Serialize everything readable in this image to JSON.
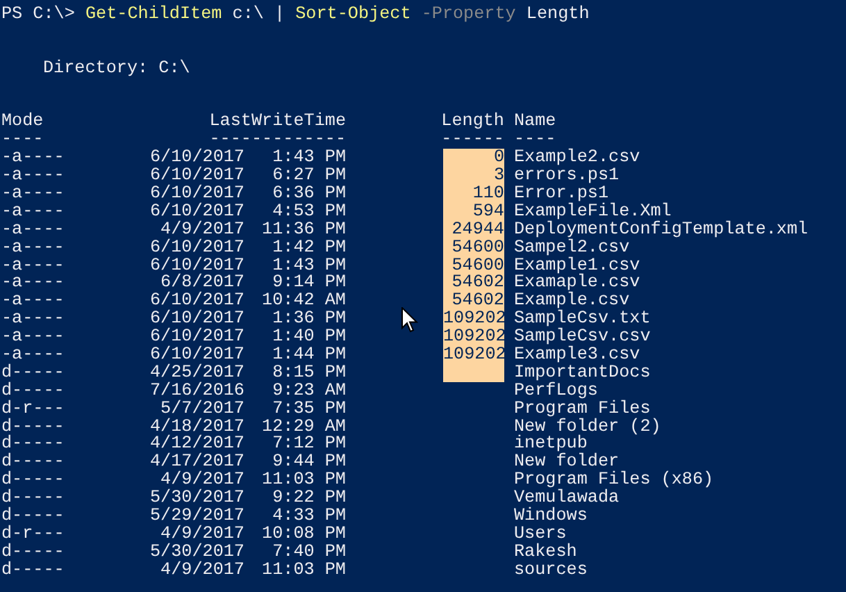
{
  "command_line": [
    {
      "kind": "prompt",
      "text": "PS C:\\> "
    },
    {
      "kind": "command",
      "text": "Get-ChildItem"
    },
    {
      "kind": "plain",
      "text": " c:\\ | "
    },
    {
      "kind": "command",
      "text": "Sort-Object"
    },
    {
      "kind": "parameter",
      "text": " -Property"
    },
    {
      "kind": "plain",
      "text": " Length"
    }
  ],
  "directory": "Directory: C:\\",
  "columns": {
    "mode": "Mode",
    "last_write_time": "LastWriteTime",
    "length": "Length",
    "name": "Name"
  },
  "underlines": {
    "mode": "----",
    "last_write_time": "-------------",
    "length": "------",
    "name": "----"
  },
  "rows": [
    {
      "mode": "-a----",
      "date": "6/10/2017",
      "time": "1:43 PM",
      "length": "0",
      "name": "Example2.csv",
      "highlighted": true
    },
    {
      "mode": "-a----",
      "date": "6/10/2017",
      "time": "6:27 PM",
      "length": "3",
      "name": "errors.ps1",
      "highlighted": true
    },
    {
      "mode": "-a----",
      "date": "6/10/2017",
      "time": "6:36 PM",
      "length": "110",
      "name": "Error.ps1",
      "highlighted": true
    },
    {
      "mode": "-a----",
      "date": "6/10/2017",
      "time": "4:53 PM",
      "length": "594",
      "name": "ExampleFile.Xml",
      "highlighted": true
    },
    {
      "mode": "-a----",
      "date": "4/9/2017",
      "time": "11:36 PM",
      "length": "24944",
      "name": "DeploymentConfigTemplate.xml",
      "highlighted": true
    },
    {
      "mode": "-a----",
      "date": "6/10/2017",
      "time": "1:42 PM",
      "length": "54600",
      "name": "Sampel2.csv",
      "highlighted": true
    },
    {
      "mode": "-a----",
      "date": "6/10/2017",
      "time": "1:43 PM",
      "length": "54600",
      "name": "Example1.csv",
      "highlighted": true
    },
    {
      "mode": "-a----",
      "date": "6/8/2017",
      "time": "9:14 PM",
      "length": "54602",
      "name": "Examaple.csv",
      "highlighted": true
    },
    {
      "mode": "-a----",
      "date": "6/10/2017",
      "time": "10:42 AM",
      "length": "54602",
      "name": "Example.csv",
      "highlighted": true
    },
    {
      "mode": "-a----",
      "date": "6/10/2017",
      "time": "1:36 PM",
      "length": "109202",
      "name": "SampleCsv.txt",
      "highlighted": true
    },
    {
      "mode": "-a----",
      "date": "6/10/2017",
      "time": "1:40 PM",
      "length": "109202",
      "name": "SampleCsv.csv",
      "highlighted": true
    },
    {
      "mode": "-a----",
      "date": "6/10/2017",
      "time": "1:44 PM",
      "length": "109202",
      "name": "Example3.csv",
      "highlighted": true
    },
    {
      "mode": "d-----",
      "date": "4/25/2017",
      "time": "8:15 PM",
      "name": "ImportantDocs",
      "highlighted": true
    },
    {
      "mode": "d-----",
      "date": "7/16/2016",
      "time": "9:23 AM",
      "name": "PerfLogs",
      "highlighted": false
    },
    {
      "mode": "d-r---",
      "date": "5/7/2017",
      "time": "7:35 PM",
      "name": "Program Files",
      "highlighted": false
    },
    {
      "mode": "d-----",
      "date": "4/18/2017",
      "time": "12:29 AM",
      "name": "New folder (2)",
      "highlighted": false
    },
    {
      "mode": "d-----",
      "date": "4/12/2017",
      "time": "7:12 PM",
      "name": "inetpub",
      "highlighted": false
    },
    {
      "mode": "d-----",
      "date": "4/17/2017",
      "time": "9:44 PM",
      "name": "New folder",
      "highlighted": false
    },
    {
      "mode": "d-----",
      "date": "4/9/2017",
      "time": "11:03 PM",
      "name": "Program Files (x86)",
      "highlighted": false
    },
    {
      "mode": "d-----",
      "date": "5/30/2017",
      "time": "9:22 PM",
      "name": "Vemulawada",
      "highlighted": false
    },
    {
      "mode": "d-----",
      "date": "5/29/2017",
      "time": "4:33 PM",
      "name": "Windows",
      "highlighted": false
    },
    {
      "mode": "d-r---",
      "date": "4/9/2017",
      "time": "10:08 PM",
      "name": "Users",
      "highlighted": false
    },
    {
      "mode": "d-----",
      "date": "5/30/2017",
      "time": "7:40 PM",
      "name": "Rakesh",
      "highlighted": false
    },
    {
      "mode": "d-----",
      "date": "4/9/2017",
      "time": "11:03 PM",
      "name": "sources",
      "highlighted": false
    }
  ]
}
